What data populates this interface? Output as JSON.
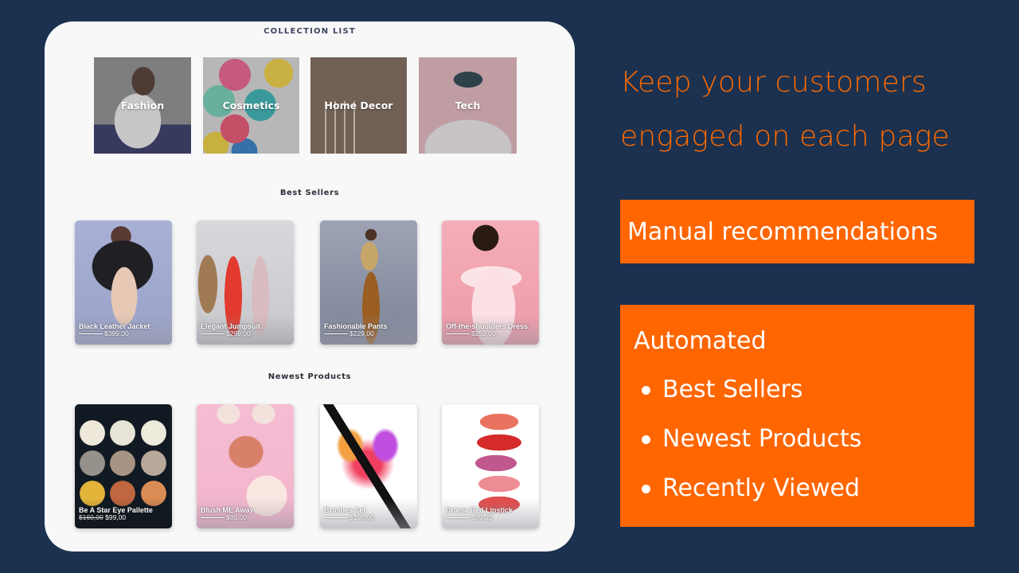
{
  "panel": {
    "collection_title": "COLLECTION LIST",
    "collections": [
      {
        "label": "Fashion"
      },
      {
        "label": "Cosmetics"
      },
      {
        "label": "Home Decor"
      },
      {
        "label": "Tech"
      }
    ],
    "best_sellers": {
      "title": "Best Sellers",
      "products": [
        {
          "name": "Black Leather Jacket",
          "price": "$399,00"
        },
        {
          "name": "Elegant Jumpsuit",
          "price": "$299,00"
        },
        {
          "name": "Fashionable Pants",
          "price": "$229,00"
        },
        {
          "name": "Off-the-shoulders Dress",
          "price": "$259,00"
        }
      ]
    },
    "newest_products": {
      "title": "Newest Products",
      "products": [
        {
          "name": "Be A Star Eye Pallette",
          "old_price": "$160,00",
          "price": "$99,00"
        },
        {
          "name": "Blush ME Away",
          "price": "$89,00"
        },
        {
          "name": "Brushes Set",
          "price": "$199,00"
        },
        {
          "name": "Drama Red Lipstick",
          "price": "$99,00"
        }
      ]
    }
  },
  "right": {
    "headline_line1": "Keep your customers",
    "headline_line2": "engaged on each page",
    "manual_label": "Manual recommendations",
    "automated_title": "Automated",
    "automated_items": [
      "Best Sellers",
      "Newest Products",
      "Recently Viewed"
    ]
  },
  "colors": {
    "background": "#1b314f",
    "accent_orange": "#ff6600",
    "headline_orange": "#ff6a00",
    "panel": "#f8f8f8"
  }
}
